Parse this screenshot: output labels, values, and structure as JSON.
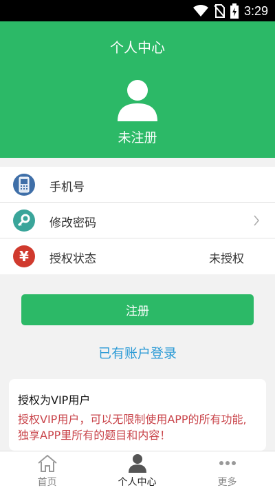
{
  "status_bar": {
    "time": "3:29"
  },
  "header": {
    "title": "个人中心",
    "username": "未注册"
  },
  "list": [
    {
      "label": "手机号",
      "value": "",
      "icon": "phone-icon",
      "color": "#3f6fa8"
    },
    {
      "label": "修改密码",
      "value": "",
      "icon": "key-icon",
      "color": "#3aa59a"
    },
    {
      "label": "授权状态",
      "value": "未授权",
      "icon": "yen-icon",
      "color": "#d03a2e"
    }
  ],
  "register_button": "注册",
  "login_link": "已有账户登录",
  "vip": {
    "title": "授权为VIP用户",
    "description": "授权VIP用户，可以无限制使用APP的所有功能, 独享APP里所有的题目和内容！"
  },
  "tabs": [
    {
      "label": "首页",
      "icon": "home-icon"
    },
    {
      "label": "个人中心",
      "icon": "person-icon"
    },
    {
      "label": "更多",
      "icon": "more-icon"
    }
  ],
  "colors": {
    "brand": "#2cb967",
    "link": "#2c9bd6",
    "warning": "#c9454b"
  }
}
